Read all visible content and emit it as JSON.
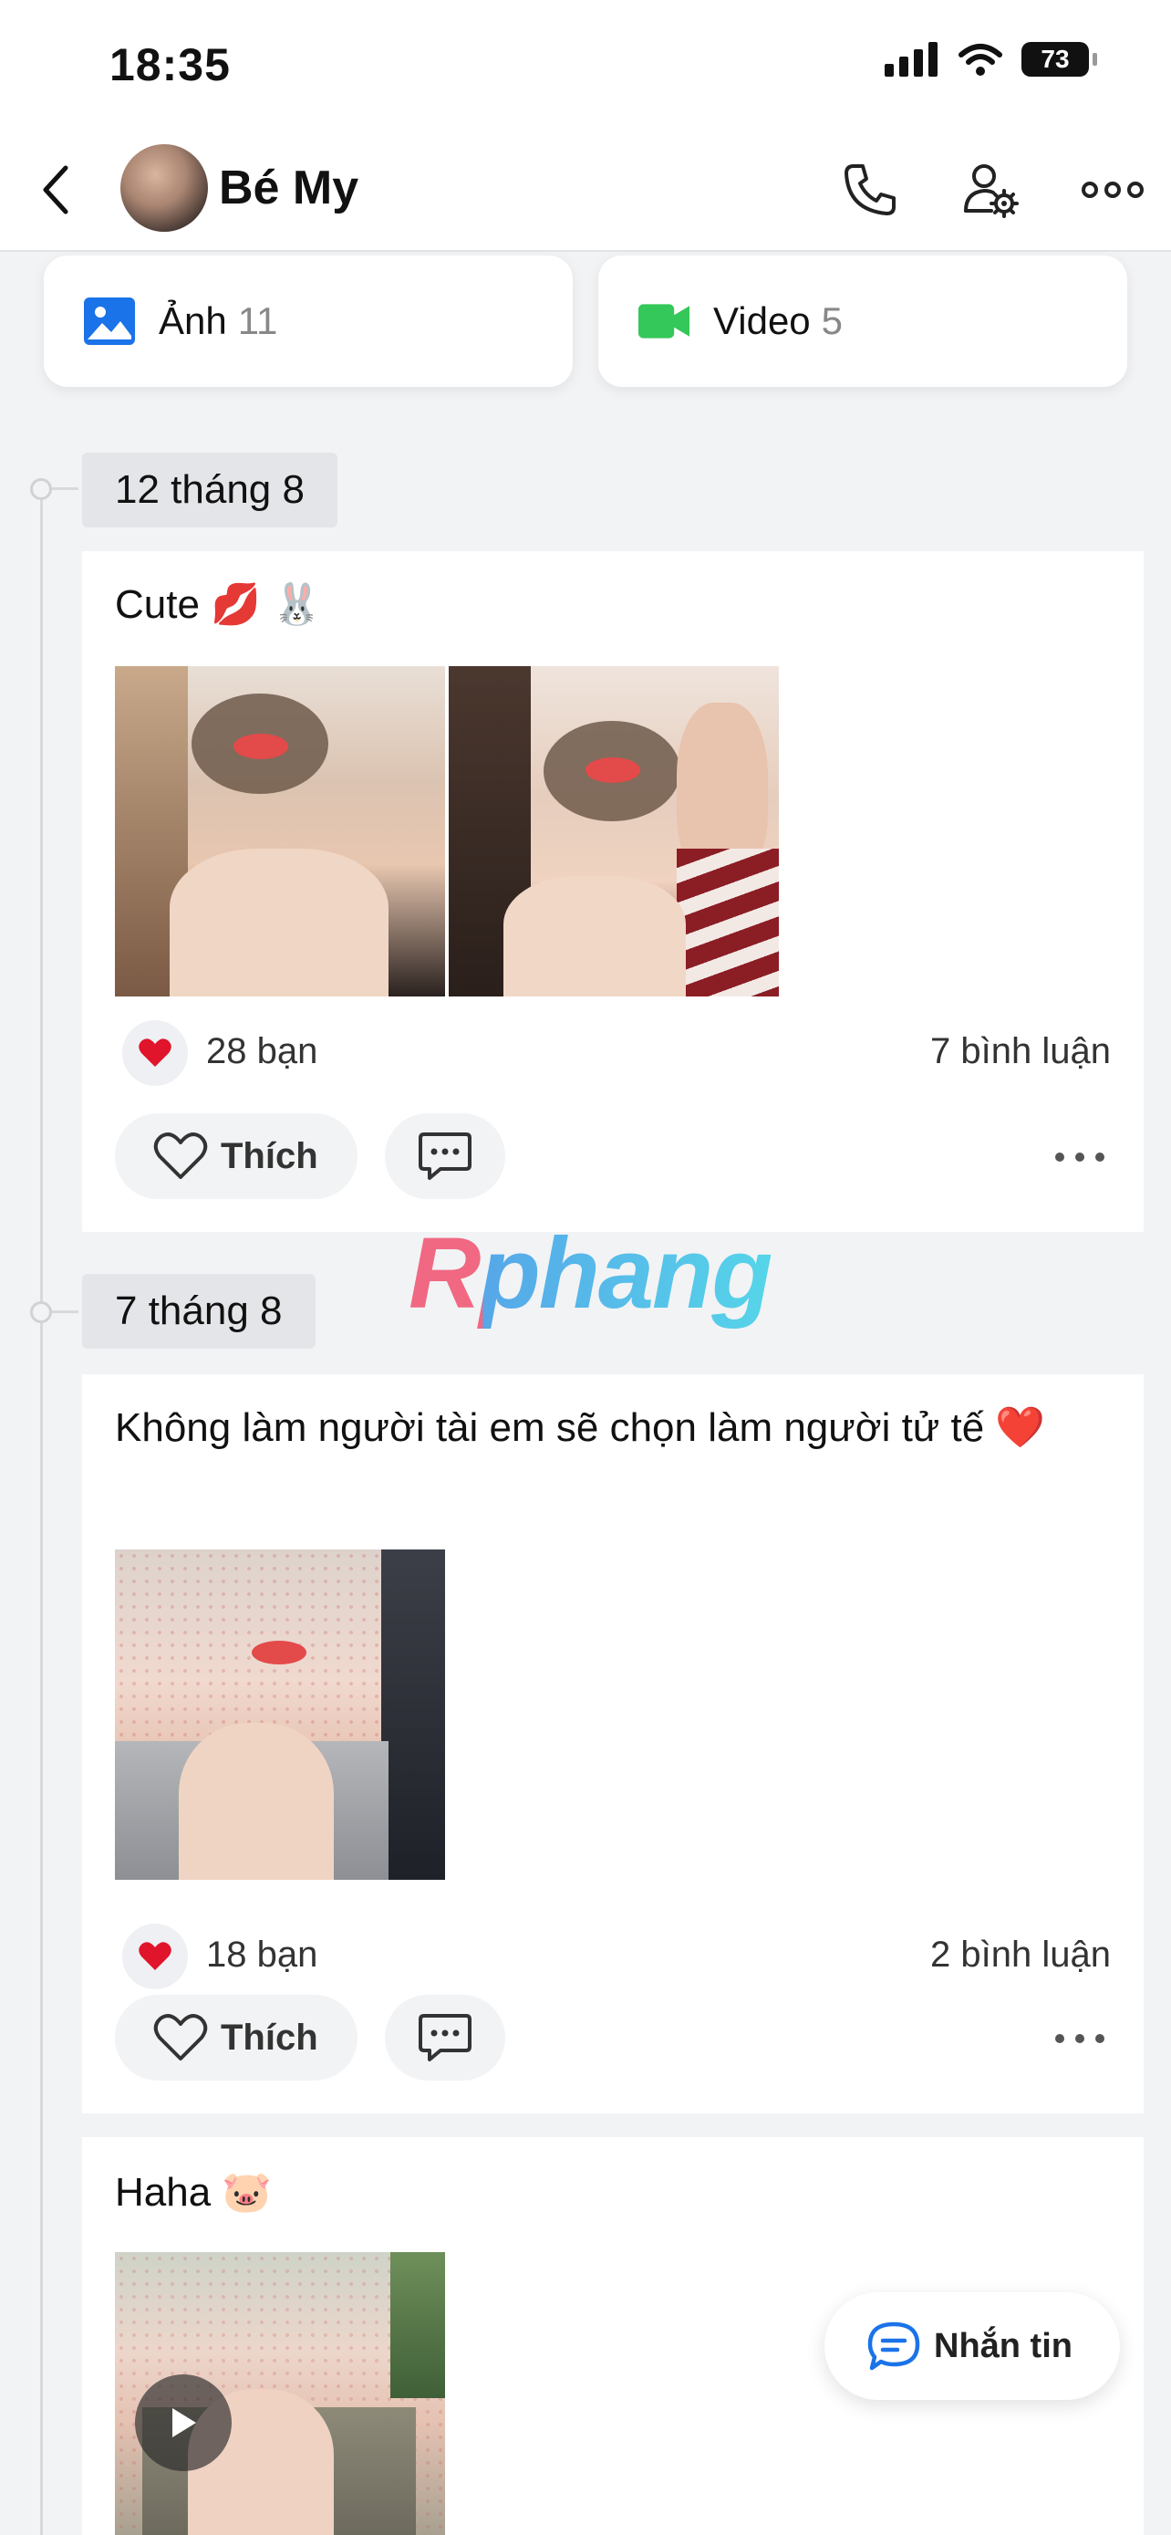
{
  "status_bar": {
    "time": "18:35",
    "battery": "73"
  },
  "header": {
    "name": "Bé My"
  },
  "media": {
    "photos_label": "Ảnh",
    "photos_count": "11",
    "videos_label": "Video",
    "videos_count": "5"
  },
  "posts": [
    {
      "date": "12 tháng 8",
      "text": "Cute 💋 🐰",
      "likes": "28 bạn",
      "comments": "7 bình luận",
      "like_label": "Thích"
    },
    {
      "date": "7 tháng 8",
      "text": "Không làm người tài em sẽ chọn làm người tử tế ❤️",
      "likes": "18 bạn",
      "comments": "2 bình luận",
      "like_label": "Thích"
    },
    {
      "text": "Haha 🐷"
    }
  ],
  "watermark": "Rphang",
  "message_button": {
    "label": "Nhắn tin"
  },
  "colors": {
    "accent": "#1a73e8",
    "video_green": "#34c759",
    "heart_red": "#e0142b"
  }
}
